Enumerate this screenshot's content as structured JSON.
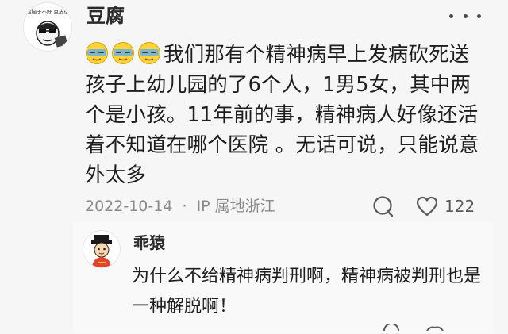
{
  "comment": {
    "username": "豆腐",
    "avatar_caption": "豆腐脑子不好  豆皮很厚",
    "emojis": [
      "sweat-smile-emoji",
      "sweat-smile-emoji",
      "sweat-smile-emoji"
    ],
    "text": "我们那有个精神病早上发病砍死送孩子上幼儿园的了6个人，1男5女，其中两个是小孩。11年前的事，精神病人好像还活着不知道在哪个医院 。无话可说，只能说意外太多",
    "date": "2022-10-14",
    "separator": "·",
    "ip_location": "IP 属地浙江",
    "like_count": "122"
  },
  "reply": {
    "username": "乖猿",
    "text": "为什么不给精神病判刑啊，精神病被判刑也是一种解脱啊！"
  }
}
